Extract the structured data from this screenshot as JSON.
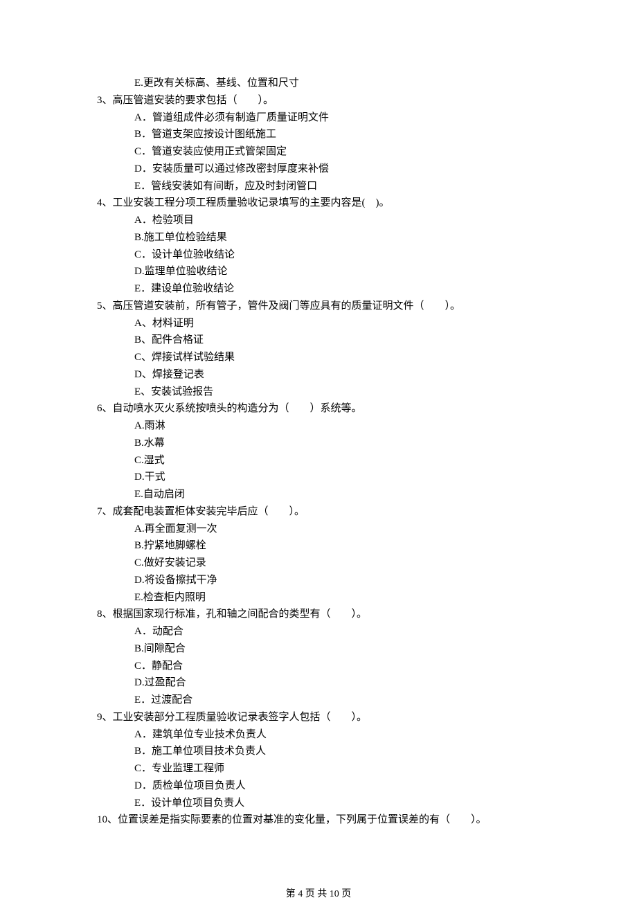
{
  "lines": [
    {
      "cls": "option-line",
      "text": "E.更改有关标高、基线、位置和尺寸"
    },
    {
      "cls": "question-line",
      "text": "3、高压管道安装的要求包括（　　）。"
    },
    {
      "cls": "option-line",
      "text": "A．管道组成件必须有制造厂质量证明文件"
    },
    {
      "cls": "option-line",
      "text": "B．管道支架应按设计图纸施工"
    },
    {
      "cls": "option-line",
      "text": "C．管道安装应使用正式管架固定"
    },
    {
      "cls": "option-line",
      "text": "D．安装质量可以通过修改密封厚度来补偿"
    },
    {
      "cls": "option-line",
      "text": "E．管线安装如有间断，应及时封闭管口"
    },
    {
      "cls": "question-line",
      "text": "4、工业安装工程分项工程质量验收记录填写的主要内容是(　)。"
    },
    {
      "cls": "option-line",
      "text": "A．检验项目"
    },
    {
      "cls": "option-line",
      "text": "B.施工单位检验结果"
    },
    {
      "cls": "option-line",
      "text": "C．设计单位验收结论"
    },
    {
      "cls": "option-line",
      "text": "D.监理单位验收结论"
    },
    {
      "cls": "option-line",
      "text": "E．建设单位验收结论"
    },
    {
      "cls": "question-line",
      "text": "5、高压管道安装前，所有管子，管件及阀门等应具有的质量证明文件（　　）。"
    },
    {
      "cls": "option-line",
      "text": "A、材料证明"
    },
    {
      "cls": "option-line",
      "text": "B、配件合格证"
    },
    {
      "cls": "option-line",
      "text": "C、焊接试样试验结果"
    },
    {
      "cls": "option-line",
      "text": "D、焊接登记表"
    },
    {
      "cls": "option-line",
      "text": "E、安装试验报告"
    },
    {
      "cls": "question-line",
      "text": "6、自动喷水灭火系统按喷头的构造分为（　　）系统等。"
    },
    {
      "cls": "option-line",
      "text": "A.雨淋"
    },
    {
      "cls": "option-line",
      "text": "B.水幕"
    },
    {
      "cls": "option-line",
      "text": "C.湿式"
    },
    {
      "cls": "option-line",
      "text": "D.干式"
    },
    {
      "cls": "option-line",
      "text": "E.自动启闭"
    },
    {
      "cls": "question-line",
      "text": "7、成套配电装置柜体安装完毕后应（　　）。"
    },
    {
      "cls": "option-line",
      "text": "A.再全面复测一次"
    },
    {
      "cls": "option-line",
      "text": "B.拧紧地脚螺栓"
    },
    {
      "cls": "option-line",
      "text": "C.做好安装记录"
    },
    {
      "cls": "option-line",
      "text": "D.将设备擦拭干净"
    },
    {
      "cls": "option-line",
      "text": "E.检查柜内照明"
    },
    {
      "cls": "question-line",
      "text": "8、根据国家现行标准，孔和轴之间配合的类型有（　　）。"
    },
    {
      "cls": "option-line",
      "text": "A．动配合"
    },
    {
      "cls": "option-line",
      "text": "B.间隙配合"
    },
    {
      "cls": "option-line",
      "text": "C．静配合"
    },
    {
      "cls": "option-line",
      "text": "D.过盈配合"
    },
    {
      "cls": "option-line",
      "text": "E．过渡配合"
    },
    {
      "cls": "question-line",
      "text": "9、工业安装部分工程质量验收记录表签字人包括（　　）。"
    },
    {
      "cls": "option-line",
      "text": "A．建筑单位专业技术负责人"
    },
    {
      "cls": "option-line",
      "text": "B．施工单位项目技术负责人"
    },
    {
      "cls": "option-line",
      "text": "C．专业监理工程师"
    },
    {
      "cls": "option-line",
      "text": "D．质检单位项目负责人"
    },
    {
      "cls": "option-line",
      "text": "E．设计单位项目负责人"
    },
    {
      "cls": "question-line",
      "text": "10、位置误差是指实际要素的位置对基准的变化量，下列属于位置误差的有（　　）。"
    }
  ],
  "footer": "第 4 页 共 10 页"
}
